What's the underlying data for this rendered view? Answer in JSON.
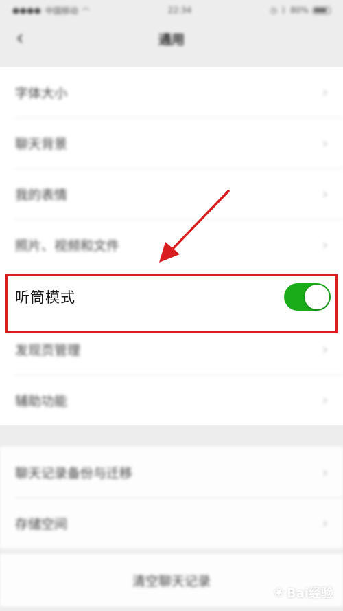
{
  "status_bar": {
    "carrier": "中国移动",
    "time": "22:34",
    "battery": "80%"
  },
  "nav": {
    "title": "通用",
    "back_glyph": "‹"
  },
  "settings": {
    "items_top": [
      {
        "label": "字体大小"
      },
      {
        "label": "聊天背景"
      },
      {
        "label": "我的表情"
      },
      {
        "label": "照片、视频和文件"
      }
    ],
    "earpiece": {
      "label": "听筒模式",
      "enabled": true
    },
    "items_mid": [
      {
        "label": "发现页管理"
      },
      {
        "label": "辅助功能"
      }
    ],
    "items_bottom": [
      {
        "label": "聊天记录备份与迁移"
      },
      {
        "label": "存储空间"
      }
    ],
    "clear_history": "清空聊天记录"
  },
  "colors": {
    "toggle_on": "#1aad19",
    "highlight": "#d81e1e"
  },
  "watermark": {
    "text": "Bai经验"
  }
}
